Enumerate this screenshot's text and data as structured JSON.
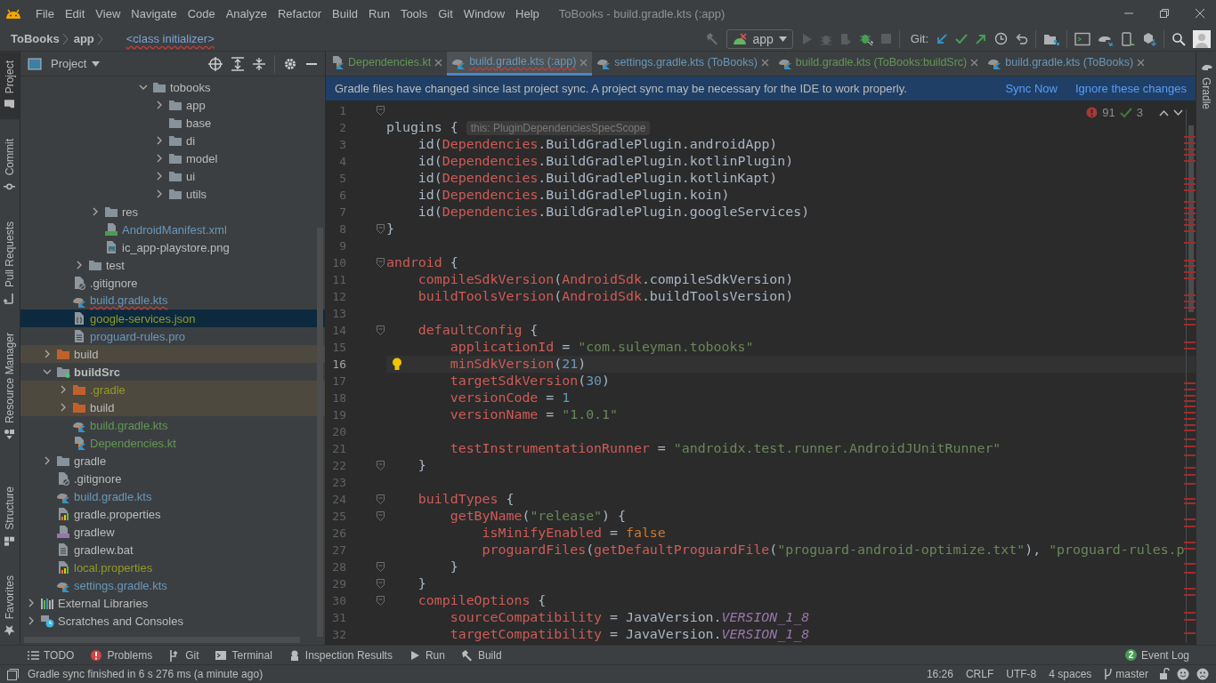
{
  "menu_bar": {
    "items": [
      "File",
      "Edit",
      "View",
      "Navigate",
      "Code",
      "Analyze",
      "Refactor",
      "Build",
      "Run",
      "Tools",
      "Git",
      "Window",
      "Help"
    ],
    "window_title": "ToBooks - build.gradle.kts (:app)"
  },
  "navigation_bar": {
    "breadcrumbs": [
      "ToBooks",
      "app"
    ],
    "context": "<class initializer>",
    "run_configuration": "app",
    "vcs_label": "Git:"
  },
  "tool_strip_left_top": [
    {
      "label": "Project",
      "kind": "project",
      "selected": true
    },
    {
      "label": "Commit",
      "kind": "commit",
      "selected": false
    },
    {
      "label": "Pull Requests",
      "kind": "pull",
      "selected": false
    },
    {
      "label": "Resource Manager",
      "kind": "resources",
      "selected": false
    }
  ],
  "tool_strip_left_bottom": [
    {
      "label": "Structure",
      "kind": "structure",
      "selected": false
    },
    {
      "label": "Favorites",
      "kind": "favorites",
      "selected": false
    }
  ],
  "tool_strip_right": [
    {
      "label": "Gradle",
      "kind": "gradle",
      "selected": false
    }
  ],
  "project": {
    "title": "Project",
    "tree": [
      {
        "children": [
          {
            "children": [
              {
                "children": [
                  {
                    "children": [
                      {
                        "children": [
                          {
                            "children": [
                              {
                                "children": [
                                  {
                                    "label": "tobooks",
                                    "kind": "folder",
                                    "color": "#bbbbbb",
                                    "expanded": true,
                                    "selected": false,
                                    "errors": false,
                                    "children": [
                                      {
                                        "label": "app",
                                        "kind": "folder",
                                        "color": "#bbbbbb",
                                        "expanded": false,
                                        "selected": false,
                                        "errors": false
                                      },
                                      {
                                        "label": "base",
                                        "kind": "folder",
                                        "color": "#bbbbbb",
                                        "selected": false,
                                        "errors": false
                                      },
                                      {
                                        "label": "di",
                                        "kind": "folder",
                                        "color": "#bbbbbb",
                                        "expanded": false,
                                        "selected": false,
                                        "errors": false
                                      },
                                      {
                                        "label": "model",
                                        "kind": "folder",
                                        "color": "#bbbbbb",
                                        "expanded": false,
                                        "selected": false,
                                        "errors": false
                                      },
                                      {
                                        "label": "ui",
                                        "kind": "folder",
                                        "color": "#bbbbbb",
                                        "expanded": false,
                                        "selected": false,
                                        "errors": false
                                      },
                                      {
                                        "label": "utils",
                                        "kind": "folder",
                                        "color": "#bbbbbb",
                                        "expanded": false,
                                        "selected": false,
                                        "errors": false
                                      }
                                    ]
                                  }
                                ]
                              }
                            ]
                          }
                        ]
                      },
                      {
                        "label": "res",
                        "kind": "folder",
                        "color": "#bbbbbb",
                        "expanded": false,
                        "selected": false,
                        "errors": false
                      },
                      {
                        "label": "AndroidManifest.xml",
                        "kind": "manifest",
                        "color": "#6897bb",
                        "selected": false,
                        "errors": false
                      },
                      {
                        "label": "ic_app-playstore.png",
                        "kind": "image",
                        "color": "#bbbbbb",
                        "selected": false,
                        "errors": false
                      }
                    ]
                  },
                  {
                    "label": "test",
                    "kind": "folder",
                    "color": "#bbbbbb",
                    "expanded": false,
                    "selected": false,
                    "errors": false
                  }
                ]
              },
              {
                "label": ".gitignore",
                "kind": "ignore-file",
                "color": "#bbbbbb",
                "selected": false,
                "errors": false
              },
              {
                "label": "build.gradle.kts",
                "kind": "kotlin-script",
                "color": "#6897bb",
                "selected": false,
                "errors": true
              },
              {
                "label": "google-services.json",
                "kind": "json",
                "color": "#939a26",
                "selected": true,
                "errors": false
              },
              {
                "label": "proguard-rules.pro",
                "kind": "text",
                "color": "#6897bb",
                "selected": false,
                "errors": false
              }
            ]
          },
          {
            "label": "build",
            "kind": "excluded-folder",
            "color": "#bbbbbb",
            "expanded": false,
            "selected": false,
            "errors": false
          },
          {
            "label": "buildSrc",
            "kind": "module",
            "color": "#bbbbbb",
            "expanded": true,
            "selected": false,
            "errors": false,
            "children": [
              {
                "label": ".gradle",
                "kind": "excluded-folder",
                "color": "#939a26",
                "expanded": false,
                "selected": false,
                "errors": false
              },
              {
                "label": "build",
                "kind": "excluded-folder",
                "color": "#bbbbbb",
                "expanded": false,
                "selected": false,
                "errors": false
              },
              {
                "label": "build.gradle.kts",
                "kind": "kotlin-script",
                "color": "#629755",
                "selected": false,
                "errors": false
              },
              {
                "label": "Dependencies.kt",
                "kind": "kotlin",
                "color": "#629755",
                "selected": false,
                "errors": false
              }
            ]
          },
          {
            "label": "gradle",
            "kind": "folder",
            "color": "#bbbbbb",
            "expanded": false,
            "selected": false,
            "errors": false
          },
          {
            "label": ".gitignore",
            "kind": "ignore-file",
            "color": "#bbbbbb",
            "selected": false,
            "errors": false
          },
          {
            "label": "build.gradle.kts",
            "kind": "kotlin-script",
            "color": "#6897bb",
            "selected": false,
            "errors": false
          },
          {
            "label": "gradle.properties",
            "kind": "properties",
            "color": "#bbbbbb",
            "selected": false,
            "errors": false
          },
          {
            "label": "gradlew",
            "kind": "shell",
            "color": "#bbbbbb",
            "selected": false,
            "errors": false
          },
          {
            "label": "gradlew.bat",
            "kind": "text",
            "color": "#bbbbbb",
            "selected": false,
            "errors": false
          },
          {
            "label": "local.properties",
            "kind": "properties",
            "color": "#939a26",
            "selected": false,
            "errors": false
          },
          {
            "label": "settings.gradle.kts",
            "kind": "kotlin-script",
            "color": "#6897bb",
            "selected": false,
            "errors": false
          }
        ]
      },
      {
        "label": "External Libraries",
        "kind": "libraries",
        "color": "#bbbbbb",
        "expanded": false,
        "selected": false,
        "errors": false
      },
      {
        "label": "Scratches and Consoles",
        "kind": "scratches",
        "color": "#bbbbbb",
        "expanded": false,
        "selected": false,
        "errors": false
      }
    ]
  },
  "editor": {
    "tabs": [
      {
        "label": "Dependencies.kt",
        "kind": "kotlin",
        "color": "#629755",
        "selected": false,
        "errors": false
      },
      {
        "label": "build.gradle.kts (:app)",
        "kind": "kotlin-script",
        "color": "#6897bb",
        "selected": true,
        "errors": true
      },
      {
        "label": "settings.gradle.kts (ToBooks)",
        "kind": "kotlin-script",
        "color": "#6897bb",
        "selected": false,
        "errors": false
      },
      {
        "label": "build.gradle.kts (ToBooks:buildSrc)",
        "kind": "kotlin-script",
        "color": "#629755",
        "selected": false,
        "errors": false
      },
      {
        "label": "build.gradle.kts (ToBooks)",
        "kind": "kotlin-script",
        "color": "#6897bb",
        "selected": false,
        "errors": false
      }
    ],
    "banner": {
      "message": "Gradle files have changed since last project sync. A project sync may be necessary for the IDE to work properly.",
      "actions": [
        "Sync Now",
        "Ignore these changes"
      ]
    },
    "inspections": {
      "errors": "91",
      "warnings": "3"
    },
    "lines": [
      {
        "n": "1",
        "kind": "fold",
        "current": false
      },
      {
        "n": "2",
        "kind": "plain",
        "current": false,
        "tokens": [
          {
            "kind": "plain",
            "text": "plugins { "
          },
          {
            "kind": "hint",
            "text": "this: PluginDependenciesSpecScope"
          }
        ]
      },
      {
        "n": "3",
        "kind": "plain",
        "current": false,
        "tokens": [
          {
            "kind": "plain",
            "text": "    id("
          },
          {
            "kind": "error",
            "text": "Dependencies"
          },
          {
            "kind": "plain",
            "text": ".BuildGradlePlugin.androidApp)"
          }
        ]
      },
      {
        "n": "4",
        "kind": "plain",
        "current": false,
        "tokens": [
          {
            "kind": "plain",
            "text": "    id("
          },
          {
            "kind": "error",
            "text": "Dependencies"
          },
          {
            "kind": "plain",
            "text": ".BuildGradlePlugin.kotlinPlugin)"
          }
        ]
      },
      {
        "n": "5",
        "kind": "plain",
        "current": false,
        "tokens": [
          {
            "kind": "plain",
            "text": "    id("
          },
          {
            "kind": "error",
            "text": "Dependencies"
          },
          {
            "kind": "plain",
            "text": ".BuildGradlePlugin.kotlinKapt)"
          }
        ]
      },
      {
        "n": "6",
        "kind": "plain",
        "current": false,
        "tokens": [
          {
            "kind": "plain",
            "text": "    id("
          },
          {
            "kind": "error",
            "text": "Dependencies"
          },
          {
            "kind": "plain",
            "text": ".BuildGradlePlugin.koin)"
          }
        ]
      },
      {
        "n": "7",
        "kind": "plain",
        "current": false,
        "tokens": [
          {
            "kind": "plain",
            "text": "    id("
          },
          {
            "kind": "error",
            "text": "Dependencies"
          },
          {
            "kind": "plain",
            "text": ".BuildGradlePlugin.googleServices)"
          }
        ]
      },
      {
        "n": "8",
        "kind": "fold",
        "current": false,
        "tokens": [
          {
            "kind": "plain",
            "text": "}"
          }
        ]
      },
      {
        "n": "9",
        "kind": "plain",
        "current": false
      },
      {
        "n": "10",
        "kind": "fold",
        "current": false,
        "tokens": [
          {
            "kind": "error",
            "text": "android"
          },
          {
            "kind": "plain",
            "text": " {"
          }
        ]
      },
      {
        "n": "11",
        "kind": "plain",
        "current": false,
        "tokens": [
          {
            "kind": "error",
            "text": "    compileSdkVersion"
          },
          {
            "kind": "plain",
            "text": "("
          },
          {
            "kind": "error",
            "text": "AndroidSdk"
          },
          {
            "kind": "plain",
            "text": ".compileSdkVersion)"
          }
        ]
      },
      {
        "n": "12",
        "kind": "plain",
        "current": false,
        "tokens": [
          {
            "kind": "error",
            "text": "    buildToolsVersion"
          },
          {
            "kind": "plain",
            "text": "("
          },
          {
            "kind": "error",
            "text": "AndroidSdk"
          },
          {
            "kind": "plain",
            "text": ".buildToolsVersion)"
          }
        ]
      },
      {
        "n": "13",
        "kind": "plain",
        "current": false
      },
      {
        "n": "14",
        "kind": "fold",
        "current": false,
        "tokens": [
          {
            "kind": "error",
            "text": "    defaultConfig"
          },
          {
            "kind": "plain",
            "text": " {"
          }
        ]
      },
      {
        "n": "15",
        "kind": "plain",
        "current": false,
        "tokens": [
          {
            "kind": "error",
            "text": "        applicationId"
          },
          {
            "kind": "plain",
            "text": " = "
          },
          {
            "kind": "string",
            "text": "\"com.suleyman.tobooks\""
          }
        ]
      },
      {
        "n": "16",
        "kind": "bulb",
        "current": true,
        "tokens": [
          {
            "kind": "error",
            "text": "        minSdkVersion"
          },
          {
            "kind": "plain",
            "text": "("
          },
          {
            "kind": "number",
            "text": "21"
          },
          {
            "kind": "plain",
            "text": ")"
          }
        ]
      },
      {
        "n": "17",
        "kind": "plain",
        "current": false,
        "tokens": [
          {
            "kind": "error",
            "text": "        targetSdkVersion"
          },
          {
            "kind": "plain",
            "text": "("
          },
          {
            "kind": "number",
            "text": "30"
          },
          {
            "kind": "plain",
            "text": ")"
          }
        ]
      },
      {
        "n": "18",
        "kind": "plain",
        "current": false,
        "tokens": [
          {
            "kind": "error",
            "text": "        versionCode"
          },
          {
            "kind": "plain",
            "text": " = "
          },
          {
            "kind": "number",
            "text": "1"
          }
        ]
      },
      {
        "n": "19",
        "kind": "plain",
        "current": false,
        "tokens": [
          {
            "kind": "error",
            "text": "        versionName"
          },
          {
            "kind": "plain",
            "text": " = "
          },
          {
            "kind": "string",
            "text": "\"1.0.1\""
          }
        ]
      },
      {
        "n": "20",
        "kind": "plain",
        "current": false
      },
      {
        "n": "21",
        "kind": "plain",
        "current": false,
        "tokens": [
          {
            "kind": "error",
            "text": "        testInstrumentationRunner"
          },
          {
            "kind": "plain",
            "text": " = "
          },
          {
            "kind": "string",
            "text": "\"androidx.test.runner.AndroidJUnitRunner\""
          }
        ]
      },
      {
        "n": "22",
        "kind": "fold",
        "current": false,
        "tokens": [
          {
            "kind": "plain",
            "text": "    }"
          }
        ]
      },
      {
        "n": "23",
        "kind": "plain",
        "current": false
      },
      {
        "n": "24",
        "kind": "fold",
        "current": false,
        "tokens": [
          {
            "kind": "error",
            "text": "    buildTypes"
          },
          {
            "kind": "plain",
            "text": " {"
          }
        ]
      },
      {
        "n": "25",
        "kind": "fold",
        "current": false,
        "tokens": [
          {
            "kind": "error",
            "text": "        getByName"
          },
          {
            "kind": "plain",
            "text": "("
          },
          {
            "kind": "string",
            "text": "\"release\""
          },
          {
            "kind": "plain",
            "text": ") {"
          }
        ]
      },
      {
        "n": "26",
        "kind": "plain",
        "current": false,
        "tokens": [
          {
            "kind": "error",
            "text": "            isMinifyEnabled"
          },
          {
            "kind": "plain",
            "text": " = "
          },
          {
            "kind": "keyword",
            "text": "false"
          }
        ]
      },
      {
        "n": "27",
        "kind": "plain",
        "current": false,
        "tokens": [
          {
            "kind": "error",
            "text": "            proguardFiles"
          },
          {
            "kind": "plain",
            "text": "("
          },
          {
            "kind": "error",
            "text": "getDefaultProguardFile"
          },
          {
            "kind": "plain",
            "text": "("
          },
          {
            "kind": "string",
            "text": "\"proguard-android-optimize.txt\""
          },
          {
            "kind": "plain",
            "text": "), "
          },
          {
            "kind": "string",
            "text": "\"proguard-rules.p"
          }
        ]
      },
      {
        "n": "28",
        "kind": "fold",
        "current": false,
        "tokens": [
          {
            "kind": "plain",
            "text": "        }"
          }
        ]
      },
      {
        "n": "29",
        "kind": "fold",
        "current": false,
        "tokens": [
          {
            "kind": "plain",
            "text": "    }"
          }
        ]
      },
      {
        "n": "30",
        "kind": "fold",
        "current": false,
        "tokens": [
          {
            "kind": "error",
            "text": "    compileOptions"
          },
          {
            "kind": "plain",
            "text": " {"
          }
        ]
      },
      {
        "n": "31",
        "kind": "plain",
        "current": false,
        "tokens": [
          {
            "kind": "error",
            "text": "        sourceCompatibility"
          },
          {
            "kind": "plain",
            "text": " = JavaVersion."
          },
          {
            "kind": "constant",
            "text": "VERSION_1_8"
          }
        ]
      },
      {
        "n": "32",
        "kind": "plain",
        "current": false,
        "tokens": [
          {
            "kind": "error",
            "text": "        targetCompatibility"
          },
          {
            "kind": "plain",
            "text": " = JavaVersion."
          },
          {
            "kind": "constant",
            "text": "VERSION_1_8"
          }
        ]
      }
    ]
  },
  "bottom_tools": [
    {
      "label": "TODO",
      "kind": "todo"
    },
    {
      "label": "Problems",
      "kind": "problems"
    },
    {
      "label": "Git",
      "kind": "git"
    },
    {
      "label": "Terminal",
      "kind": "terminal"
    },
    {
      "label": "Inspection Results",
      "kind": "inspection"
    },
    {
      "label": "Run",
      "kind": "run"
    },
    {
      "label": "Build",
      "kind": "build"
    }
  ],
  "event_log": {
    "label": "Event Log",
    "count": "2"
  },
  "status_bar": {
    "message": "Gradle sync finished in 6 s 276 ms (a minute ago)",
    "position": "16:26",
    "line_separator": "CRLF",
    "encoding": "UTF-8",
    "indent": "4 spaces",
    "branch": "master"
  }
}
